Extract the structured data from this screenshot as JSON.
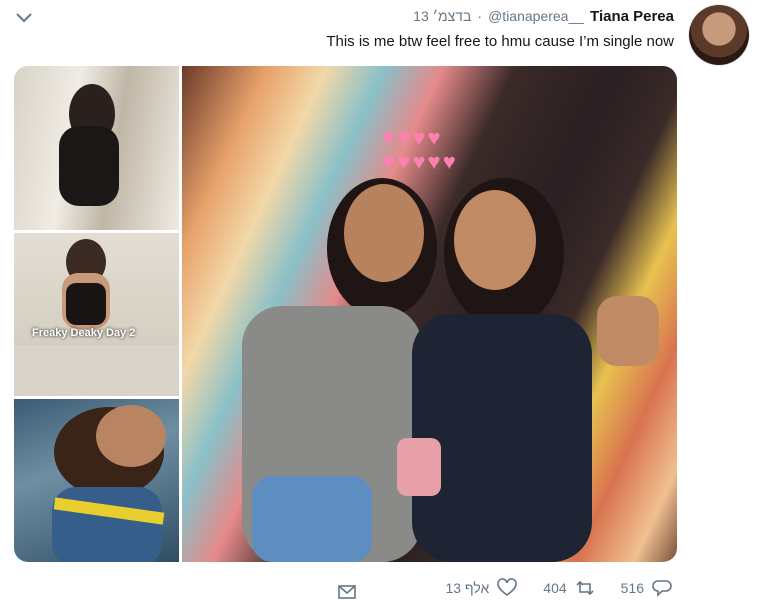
{
  "tweet": {
    "author_name": "Tiana Perea",
    "handle": "@tianaperea__",
    "separator": "·",
    "date": "13 בדצמ׳",
    "text": "This is me btw feel free to hmu cause I’m single now"
  },
  "media": {
    "overlay_text": "Freaky Deaky Day 2"
  },
  "actions": {
    "replies": "516",
    "retweets": "404",
    "likes": "13 אלף"
  },
  "icons": [
    "chevron-down-icon",
    "reply-icon",
    "retweet-icon",
    "heart-icon",
    "mail-icon"
  ],
  "colors": {
    "text": "#14171a",
    "secondary": "#657786"
  }
}
